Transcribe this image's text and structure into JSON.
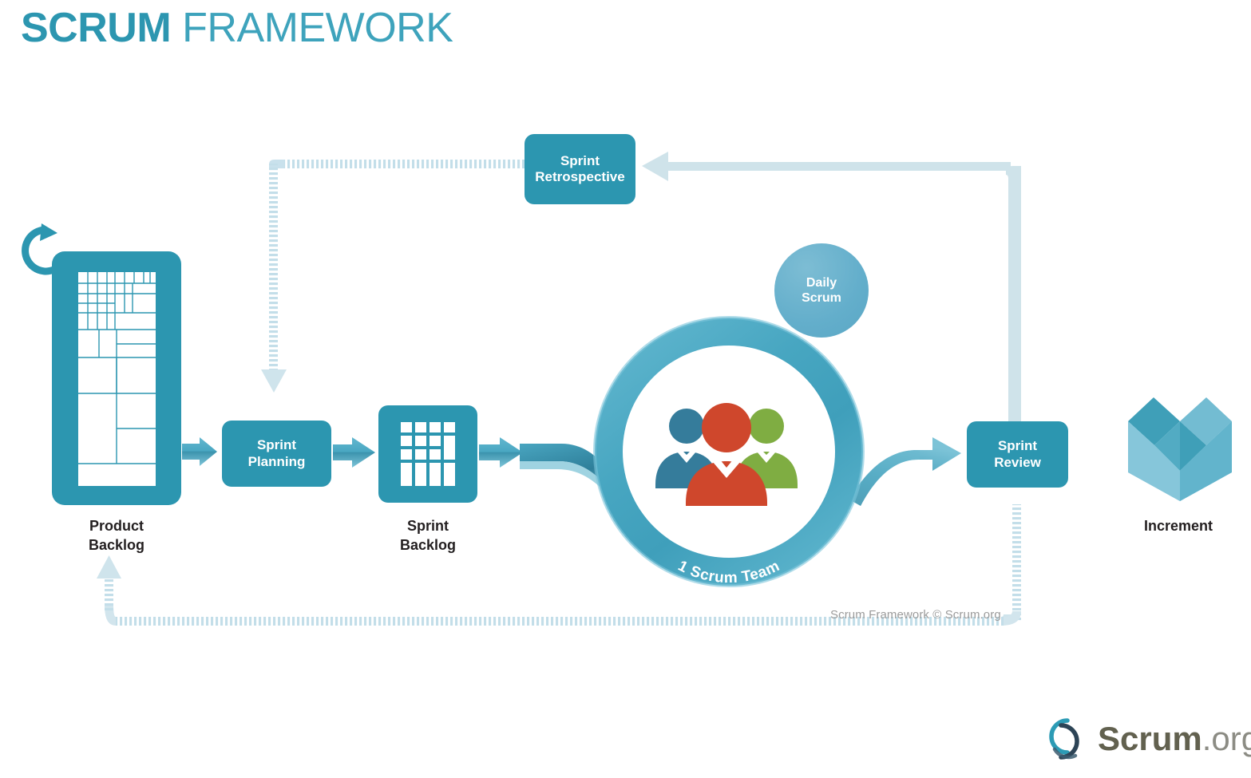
{
  "title": {
    "strong": "SCRUM",
    "light": "FRAMEWORK"
  },
  "stages": {
    "sprint_retrospective": "Sprint\nRetrospective",
    "sprint_planning": "Sprint\nPlanning",
    "sprint_review": "Sprint\nReview",
    "daily_scrum": "Daily\nScrum"
  },
  "artifacts": {
    "product_backlog": "Product\nBacklog",
    "sprint_backlog": "Sprint\nBacklog",
    "increment": "Increment"
  },
  "circle": {
    "team_label": "1 Scrum Team"
  },
  "footnote": "Scrum Framework © Scrum.org",
  "logo": {
    "name": "Scrum",
    "tld": ".org"
  },
  "colors": {
    "teal": "#2C96B0",
    "teal_light": "#6EB4CE",
    "dashed_line": "#cfe4ec",
    "solid_line": "#cfe3ea",
    "person_blue": "#357C9B",
    "person_red": "#CF472C",
    "person_green": "#7FAD42",
    "caption_text": "#231f20",
    "footnote_text": "#9b9b9b",
    "logo_name": "#62614F",
    "logo_tld": "#8c8c84"
  }
}
